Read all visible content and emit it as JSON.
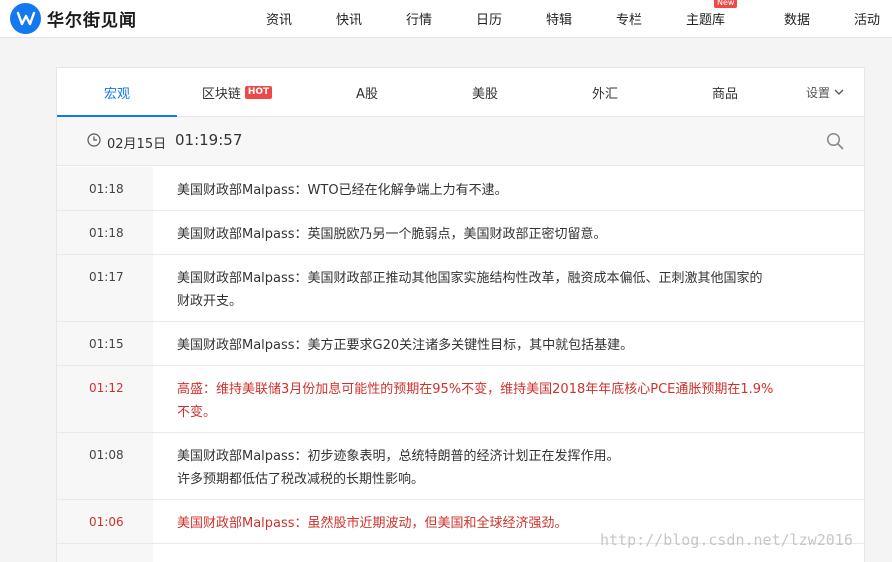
{
  "header": {
    "logo_text": "华尔街见闻",
    "nav": [
      "资讯",
      "快讯",
      "行情",
      "日历",
      "特辑",
      "专栏",
      "主题库",
      "数据",
      "活动"
    ],
    "new_badge": "New"
  },
  "tabs": {
    "items": [
      "宏观",
      "区块链",
      "A股",
      "美股",
      "外汇",
      "商品"
    ],
    "hot_badge": "HOT",
    "active": "宏观",
    "settings_label": "设置"
  },
  "timebar": {
    "date": "02月15日",
    "time": "01:19:57"
  },
  "news": [
    {
      "time": "01:18",
      "lines": [
        "美国财政部Malpass：WTO已经在化解争端上力有不逮。"
      ],
      "important": false
    },
    {
      "time": "01:18",
      "lines": [
        "美国财政部Malpass：英国脱欧乃另一个脆弱点，美国财政部正密切留意。"
      ],
      "important": false
    },
    {
      "time": "01:17",
      "lines": [
        "美国财政部Malpass：美国财政部正推动其他国家实施结构性改革，融资成本偏低、正刺激其他国家的",
        "财政开支。"
      ],
      "important": false
    },
    {
      "time": "01:15",
      "lines": [
        "美国财政部Malpass：美方正要求G20关注诸多关键性目标，其中就包括基建。"
      ],
      "important": false
    },
    {
      "time": "01:12",
      "lines": [
        "高盛：维持美联储3月份加息可能性的预期在95%不变，维持美国2018年年底核心PCE通胀预期在1.9%",
        "不变。"
      ],
      "important": true
    },
    {
      "time": "01:08",
      "lines": [
        "美国财政部Malpass：初步迹象表明，总统特朗普的经济计划正在发挥作用。",
        "许多预期都低估了税改减税的长期性影响。"
      ],
      "important": false
    },
    {
      "time": "01:06",
      "lines": [
        "美国财政部Malpass：虽然股市近期波动，但美国和全球经济强劲。"
      ],
      "important": true
    }
  ],
  "watermark": "http://blog.csdn.net/lzw2016",
  "colors": {
    "accent": "#1478f0",
    "important": "#d0312d",
    "badge": "#f04848"
  }
}
